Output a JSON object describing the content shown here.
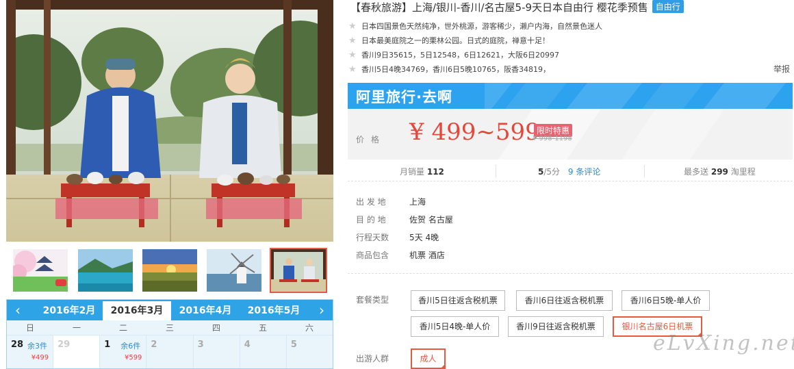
{
  "product": {
    "title": "【春秋旅游】上海/银川-香川/名古屋5-9天日本自由行 樱花季预售",
    "type_badge": "自由行"
  },
  "features": [
    "日本四国景色天然纯净，世外桃源，游客稀少，濑户内海，自然景色迷人",
    "日本最美庭院之一的栗林公园。日式的庭院，禅意十足！",
    "香川9日35615，5日12548，6日12621，大阪6日20997",
    "香川5日4晚34769，香川6日5晚10765，阪香34819，"
  ],
  "report_label": "举报",
  "brand": {
    "name": "阿里旅行·去啊",
    "color": "#2da3ef"
  },
  "price": {
    "label": "价格",
    "current": "¥ 499~599",
    "sale_tag": "限时特惠",
    "original": "¥ 998-1198",
    "color": "#e4483b"
  },
  "stats": {
    "monthly_sales_label": "月销量",
    "monthly_sales": "112",
    "rating": "5",
    "rating_suffix": "/5分",
    "reviews": "9 条评论",
    "points_prefix": "最多送",
    "points": "299",
    "points_suffix": "淘里程"
  },
  "properties": [
    {
      "key": "出 发 地",
      "value": "上海"
    },
    {
      "key": "目 的 地",
      "value": "佐贺  名古屋"
    },
    {
      "key": "行程天数",
      "value": "5天 4晚"
    },
    {
      "key": "商品包含",
      "value": "机票  酒店"
    }
  ],
  "package": {
    "label": "套餐类型",
    "options": [
      "香川5日往返含税机票",
      "香川6日往返含税机票",
      "香川6日5晚-单人价",
      "香川5日4晚-单人价",
      "香川9日往返含税机票",
      "银川名古屋6日机票"
    ],
    "selected": "银川名古屋6日机票"
  },
  "travelers": {
    "label": "出游人群",
    "selected": "成人"
  },
  "calendar": {
    "months": [
      "2016年2月",
      "2016年3月",
      "2016年4月",
      "2016年5月"
    ],
    "active_month": "2016年3月",
    "weekdays": [
      "日",
      "一",
      "二",
      "三",
      "四",
      "五",
      "六"
    ],
    "days": [
      {
        "num": "28",
        "stock": "余3件",
        "price": "¥499"
      },
      {
        "num": "29",
        "stock": "",
        "price": ""
      },
      {
        "num": "1",
        "stock": "余6件",
        "price": "¥599"
      },
      {
        "num": "2",
        "stock": "",
        "price": ""
      },
      {
        "num": "3",
        "stock": "",
        "price": ""
      },
      {
        "num": "4",
        "stock": "",
        "price": ""
      },
      {
        "num": "5",
        "stock": "",
        "price": ""
      }
    ]
  },
  "gallery": {
    "thumbnails": [
      "castle-sakura",
      "lake-mountain",
      "sunset-field",
      "windmill-sea",
      "two-men-tea"
    ],
    "active_thumbnail": "two-men-tea"
  },
  "watermark": "eLvXing.net"
}
